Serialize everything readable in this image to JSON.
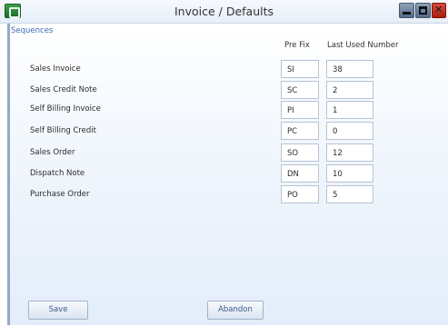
{
  "window": {
    "title": "Invoice / Defaults",
    "controls": {
      "minimize": "minimize-icon",
      "maximize": "maximize-icon",
      "close": "close-icon"
    }
  },
  "section": {
    "title": "Sequences"
  },
  "columns": {
    "prefix": "Pre Fix",
    "last": "Last Used Number"
  },
  "rows": [
    {
      "label": "Sales Invoice",
      "prefix": "SI",
      "last": "38"
    },
    {
      "label": "Sales Credit Note",
      "prefix": "SC",
      "last": "2"
    },
    {
      "label": "Self Billing Invoice",
      "prefix": "PI",
      "last": "1"
    },
    {
      "label": "Self Billing Credit",
      "prefix": "PC",
      "last": "0"
    },
    {
      "label": "Sales Order",
      "prefix": "SO",
      "last": "12"
    },
    {
      "label": "Dispatch Note",
      "prefix": "DN",
      "last": "10"
    },
    {
      "label": "Purchase Order",
      "prefix": "PO",
      "last": "5"
    }
  ],
  "buttons": {
    "save": "Save",
    "abandon": "Abandon"
  }
}
